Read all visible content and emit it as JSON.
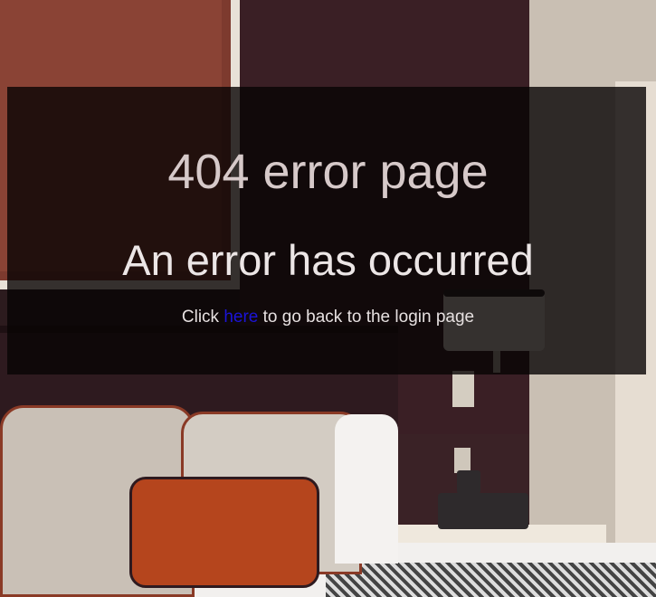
{
  "error": {
    "title": "404 error page",
    "subtitle": "An error has occurred",
    "message_prefix": "Click",
    "link_text": "here",
    "message_suffix": "to go back to the login page"
  },
  "colors": {
    "overlay": "#080404",
    "title_text": "#d6c9c9",
    "link": "#1b14d8"
  }
}
